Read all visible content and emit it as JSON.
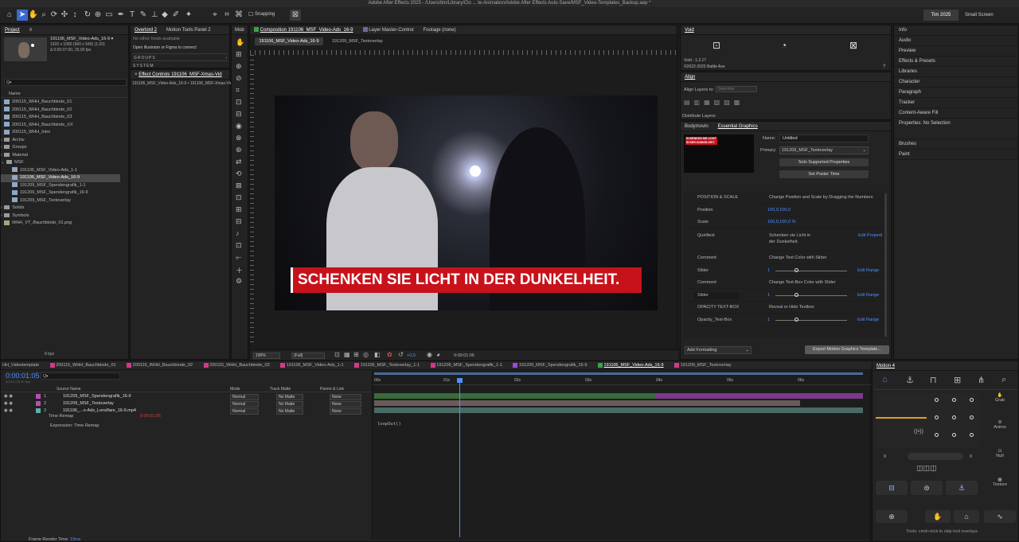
{
  "app": {
    "title": "Adobe After Effects 2025 - /Users/tim/Library/Clo ... te-Animation/Adobe After Effects Auto-Save/MSF_Video-Templates_Backup.aep *",
    "workspace": "Tim 2025",
    "workspace2": "Small Screen"
  },
  "toolbar": {
    "snapping": "Snapping"
  },
  "project": {
    "tab": "Project",
    "comp_name": "191106_MSF_Video-Ads_16-9 ▾",
    "comp_size": "1920 x 1080 (960 x 540) (1,00)",
    "comp_dur": "Δ 0:00:07:00, 25,00 fps",
    "search": "Q▾",
    "col_name": "Name",
    "bpc": "8 bpc",
    "items": [
      "200115_WHH_Bauchbinde_01",
      "200115_WHH_Bauchbinde_02",
      "200115_WHH_Bauchbinde_03",
      "200115_WHH_Bauchbinde_XX",
      "200115_WHH_Intro",
      "Archiv",
      "Groups",
      "Material",
      "MSF",
      "191106_MSF_Video-Ads_1-1",
      "191106_MSF_Video-Ads_16-9",
      "191209_MSF_Spendengrafik_1-1",
      "191209_MSF_Spendengrafik_16-9",
      "191209_MSF_Textoverlay",
      "Solids",
      "Symbols",
      "WHH_VT_Bauchbinde_01.png"
    ]
  },
  "overlord": {
    "tab": "Overlord 2",
    "tab2": "Motion Tools Panel 2",
    "no_hosts": "No other hosts available",
    "open": "Open Illustrator or Figma to connect",
    "groups": "GROUPS",
    "system": "SYSTEM"
  },
  "effect_controls": {
    "tab": "Effect Controls 191106_MSF-Xmas-Vid",
    "sub": "191106_MSF_Video-Ads_16-9 • 191106_MSF-Xmas-Vid"
  },
  "mob_tab": "Mob",
  "comp": {
    "tab": "Composition 191106_MSF_Video-Ads_16-9",
    "tab2": "Layer Master-Control",
    "tab3": "Footage (none)",
    "sub1": "191106_MSF_Video-Ads_16-9",
    "sub2": "191209_MSF_Textoverlay",
    "overlay_text": "SCHENKEN SIE LICHT IN DER DUNKELHEIT.",
    "zoom": "100%",
    "res": "(Full)",
    "exposure": "+0,0",
    "timecode": "0:00:01:05"
  },
  "void": {
    "tab": "Void",
    "version": "Void - 1.2.17",
    "copyright": "©2022-2025 Battle Axe"
  },
  "align": {
    "tab": "Align",
    "layers_to": "Align Layers to:",
    "target": "Selection",
    "distribute": "Distribute Layers:"
  },
  "eg": {
    "tab1": "Bodymovin",
    "tab2": "Essential Graphics",
    "name_label": "Name:",
    "name_val": "Untitled",
    "primary_label": "Primary:",
    "primary_val": "191209_MSF_Textoverlay",
    "solo": "Solo Supported Properties",
    "poster": "Set Poster Time",
    "thumb_text": "SCHENKEN SIE LICHT IN DER DUNKELHEIT.",
    "rows": [
      {
        "a": "POSITION & SCALE",
        "b": "Change Position and Scale by Dragging the Numbers",
        "c": "",
        "d": ""
      },
      {
        "a": "Position",
        "b": "",
        "c": "100,0,100,0",
        "d": ""
      },
      {
        "a": "Scale",
        "b": "",
        "c": "100,0,100,0 %",
        "d": ""
      },
      {
        "a": "Quelltext",
        "b": "Schenken sie Licht in der Dunkelheit.",
        "c": "",
        "d": "Edit Properti"
      },
      {
        "a": "Comment",
        "b": "Change Text Color with Slider",
        "c": "",
        "d": ""
      },
      {
        "a": "Slider",
        "b": "",
        "c": "1",
        "d": "Edit Range"
      },
      {
        "a": "Comment",
        "b": "Change Text-Box Color with Slider",
        "c": "",
        "d": ""
      },
      {
        "a": "Slider",
        "b": "",
        "c": "1",
        "d": "Edit Range"
      },
      {
        "a": "OPACITY TEXT-BOX",
        "b": "Reveal or Hide Textbox",
        "c": "",
        "d": ""
      },
      {
        "a": "Opacity_Text-Box",
        "b": "",
        "c": "1",
        "d": "Edit Range"
      }
    ],
    "add": "Add Formatting",
    "export": "Export Motion Graphics Template..."
  },
  "right": {
    "items": [
      "Info",
      "Audio",
      "Preview",
      "Effects & Presets",
      "Libraries",
      "Character",
      "Paragraph",
      "Tracker",
      "Content-Aware Fill"
    ],
    "props": "Properties: No Selection",
    "items2": [
      "Brushes",
      "Paint"
    ]
  },
  "timeline": {
    "tabs": [
      "HH_Videotemplate",
      "200115_WHH_Bauchbinde_01",
      "200115_WHH_Bauchbinde_02",
      "200115_WHH_Bauchbinde_03",
      "191106_MSF_Video-Ads_1-1",
      "191106_MSF_Textoverlay_1-1",
      "191209_MSF_Spendengrafik_1-1",
      "191209_MSF_Spendengrafik_16-9",
      "191106_MSF_Video-Ads_16-9",
      "191209_MSF_Textoverlay"
    ],
    "time": "0:00:01:05",
    "frames": "00029 (25.00 fps)",
    "col_source": "Source Name",
    "col_mode": "Mode",
    "col_track": "Track Matte",
    "col_parent": "Parent & Link",
    "layers": [
      {
        "n": "1",
        "name": "191209_MSF_Spendengrafik_16-9",
        "mode": "Normal",
        "matte": "No Matte",
        "parent": "None",
        "color": "#b64fb0"
      },
      {
        "n": "2",
        "name": "191209_MSF_Textoverlay",
        "mode": "Normal",
        "matte": "No Matte",
        "parent": "None",
        "color": "#b64fb0"
      },
      {
        "n": "3",
        "name": "191106_...o-Ads_Lensflare_16-9.mp4",
        "mode": "Normal",
        "matte": "No Matte",
        "parent": "None",
        "color": "#5fb0a0"
      }
    ],
    "prop": "Time Remap",
    "prop_val": "0:00:01:05",
    "expr_label": "Expression: Time Remap",
    "expr": "loopOut()",
    "ruler": [
      "00s",
      "01s",
      "02s",
      "03s",
      "04s",
      "05s",
      "06s"
    ],
    "render": "Frame Render Time:",
    "render_val": "19ms"
  },
  "motion": {
    "tab": "Motion 4",
    "grab": "Grab",
    "animo": "Animo",
    "null": "Null",
    "texture": "Texture",
    "num_l": "0",
    "num_r": "0",
    "tip": "Tools: cmd+click to skip tool overlays"
  }
}
